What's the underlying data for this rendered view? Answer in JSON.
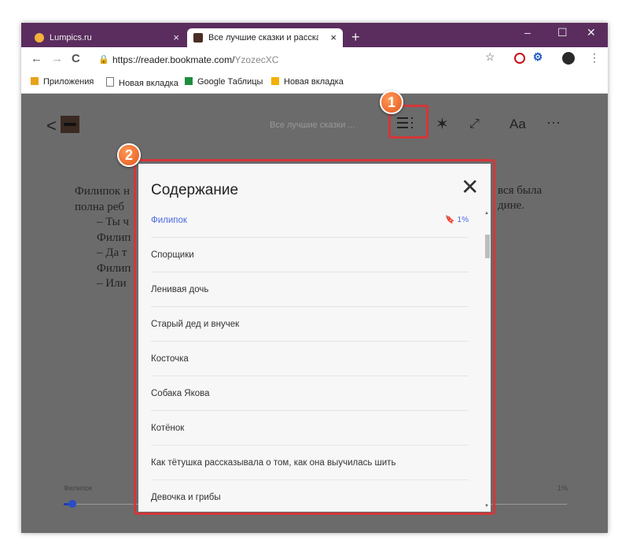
{
  "browser": {
    "tabs": [
      {
        "title": "Lumpics.ru",
        "close": "×"
      },
      {
        "title": "Все лучшие сказки и рассказы,",
        "close": "×"
      }
    ],
    "new_tab": "+",
    "window_controls": {
      "minimize": "–",
      "maximize": "☐",
      "close": "✕"
    },
    "nav": {
      "back": "←",
      "forward": "→",
      "reload": "C"
    },
    "url": {
      "host": "https://reader.bookmate.com/",
      "path": "YzozecXC"
    },
    "bookmark_star": "☆",
    "menu": "⋮",
    "bookmarks": [
      {
        "label": "Приложения",
        "color": "#e8a21a"
      },
      {
        "label": "Новая вкладка",
        "color": "#777777"
      },
      {
        "label": "Google Таблицы",
        "color": "#1e8e3e"
      },
      {
        "label": "Новая вкладка",
        "color": "#f2b100"
      }
    ]
  },
  "reader": {
    "back": "<",
    "book_title": "Все лучшие сказки ...",
    "toolbar": {
      "star": "✶",
      "fullscreen": "⤢",
      "font": "Aa",
      "more": "···"
    },
    "text_lines": [
      "Филипок н",
      "полна реб",
      "– Ты ч",
      "Филип",
      "– Да т",
      "Филип",
      "– Или"
    ],
    "right_fragments": [
      "вся была",
      "дине."
    ],
    "progress": {
      "left_label": "Филипок",
      "right_label": "1%",
      "value": 0.01
    }
  },
  "toc": {
    "title": "Содержание",
    "close": "✕",
    "items": [
      {
        "label": "Филипок",
        "pct": "🔖 1%",
        "active": true
      },
      {
        "label": "Спорщики"
      },
      {
        "label": "Ленивая дочь"
      },
      {
        "label": "Старый дед и внучек"
      },
      {
        "label": "Косточка"
      },
      {
        "label": "Собака Якова"
      },
      {
        "label": "Котёнок"
      },
      {
        "label": "Как тётушка рассказывала о том, как она выучилась шить"
      },
      {
        "label": "Девочка и грибы"
      }
    ]
  },
  "annotations": {
    "step1": "1",
    "step2": "2"
  },
  "colors": {
    "accent": "#d3373a",
    "link": "#4a6ae0",
    "tabstrip": "#5b2d5f"
  }
}
